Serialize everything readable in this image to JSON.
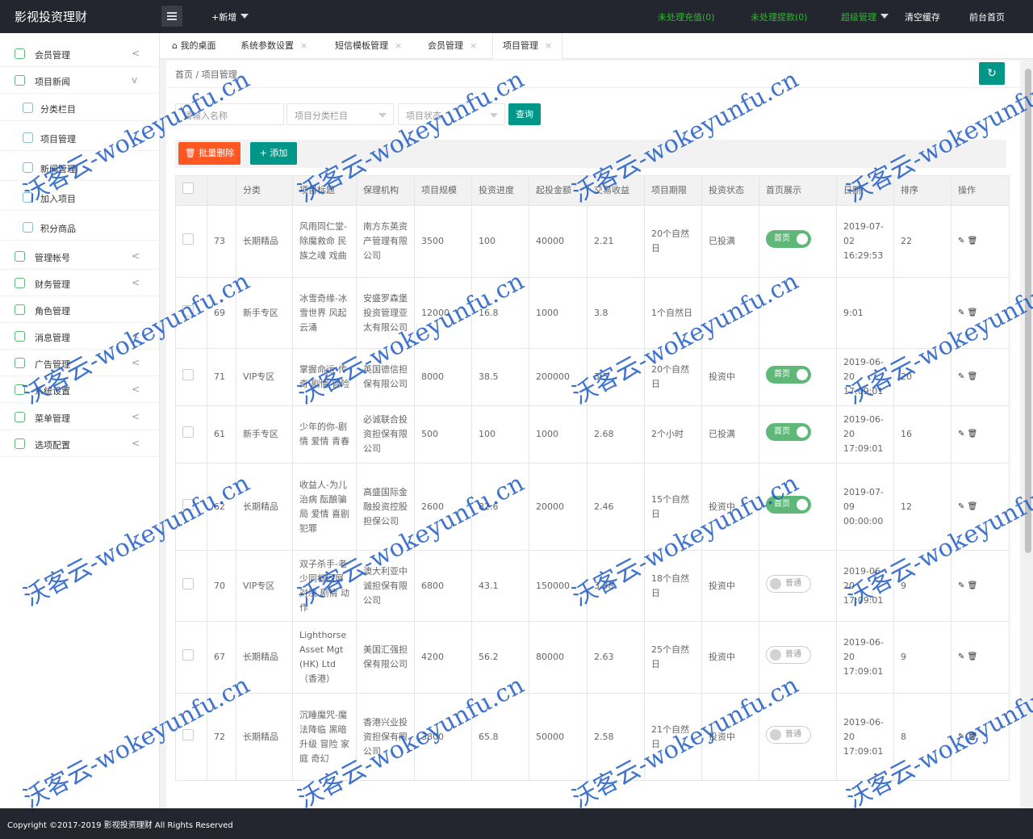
{
  "app": {
    "title": "影视投资理财"
  },
  "topbar": {
    "new_label": "+新增",
    "pending_recharge": "未处理充值(0)",
    "pending_withdraw": "未处理提款(0)",
    "super_admin": "超级管理",
    "clear_cache": "清空缓存",
    "front_home": "前台首页"
  },
  "sidebar": {
    "items": [
      {
        "label": "会员管理"
      },
      {
        "label": "项目新闻"
      },
      {
        "label": "分类栏目"
      },
      {
        "label": "项目管理"
      },
      {
        "label": "新闻管理"
      },
      {
        "label": "加入项目"
      },
      {
        "label": "积分商品"
      },
      {
        "label": "管理帐号"
      },
      {
        "label": "财务管理"
      },
      {
        "label": "角色管理"
      },
      {
        "label": "消息管理"
      },
      {
        "label": "广告管理"
      },
      {
        "label": "系统设置"
      },
      {
        "label": "菜单管理"
      },
      {
        "label": "选项配置"
      }
    ]
  },
  "tabs": [
    {
      "label": "我的桌面"
    },
    {
      "label": "系统参数设置"
    },
    {
      "label": "短信模板管理"
    },
    {
      "label": "会员管理"
    },
    {
      "label": "项目管理"
    }
  ],
  "breadcrumb": {
    "home": "首页",
    "current": "项目管理"
  },
  "filters": {
    "name_placeholder": "请输入名称",
    "category_placeholder": "项目分类栏目",
    "status_placeholder": "项目状态",
    "query_label": "查询"
  },
  "toolbar": {
    "batch_delete": "批量删除",
    "add": "添加"
  },
  "table": {
    "headers": [
      "分类",
      "项目标题",
      "保理机构",
      "项目规模",
      "投资进度",
      "起投金额",
      "交易收益",
      "项目期限",
      "投资状态",
      "首页展示",
      "日期",
      "排序",
      "操作"
    ],
    "rows": [
      {
        "id": "73",
        "cat": "长期精品",
        "title": "风雨同仁堂-除魔救命 民族之魂 戏曲",
        "org": "南方东英资产管理有限公司",
        "scale": "3500",
        "progress": "100",
        "min": "40000",
        "profit": "2.21",
        "term": "20个自然日",
        "status": "已投满",
        "show": "首页",
        "show_on": true,
        "date": "2019-07-02 16:29:53",
        "sort": "22"
      },
      {
        "id": "69",
        "cat": "新手专区",
        "title": "冰雪奇缘-冰雪世界 风起云涌",
        "org": "安盛罗森堡投资管理亚太有限公司",
        "scale": "12000",
        "progress": "16.8",
        "min": "1000",
        "profit": "3.8",
        "term": "1个自然日",
        "status": "",
        "show": "",
        "show_on": null,
        "date": "9:01",
        "sort": ""
      },
      {
        "id": "71",
        "cat": "VIP专区",
        "title": "掌握命运-传奇 剧情 冒险",
        "org": "英国德信担保有限公司",
        "scale": "8000",
        "progress": "38.5",
        "min": "200000",
        "profit": "3.5",
        "term": "20个自然日",
        "status": "投资中",
        "show": "首页",
        "show_on": true,
        "date": "2019-06-20 17:09:01",
        "sort": "20"
      },
      {
        "id": "61",
        "cat": "新手专区",
        "title": "少年的你-剧情 爱情 青春",
        "org": "必诚联合投资担保有限公司",
        "scale": "500",
        "progress": "100",
        "min": "1000",
        "profit": "2.68",
        "term": "2个小时",
        "status": "已投满",
        "show": "首页",
        "show_on": true,
        "date": "2019-06-20 17:09:01",
        "sort": "16"
      },
      {
        "id": "62",
        "cat": "长期精品",
        "title": "收益人-为儿治病 酝酿骗局 爱情 喜剧 犯罪",
        "org": "高盛国际金融投资控股担保公司",
        "scale": "2600",
        "progress": "82.6",
        "min": "20000",
        "profit": "2.46",
        "term": "15个自然日",
        "status": "投资中",
        "show": "首页",
        "show_on": true,
        "date": "2019-07-09 00:00:00",
        "sort": "12"
      },
      {
        "id": "70",
        "cat": "VIP专区",
        "title": "双子杀手-老少同框同屏对决 剧情 动作",
        "org": "澳大利亚中诚担保有限公司",
        "scale": "6800",
        "progress": "43.1",
        "min": "150000",
        "profit": "3.38",
        "term": "18个自然日",
        "status": "投资中",
        "show": "普通",
        "show_on": false,
        "date": "2019-06-20 17:09:01",
        "sort": "9"
      },
      {
        "id": "67",
        "cat": "长期精品",
        "title": "Lighthorse Asset Mgt (HK) Ltd（香港）",
        "org": "美国汇强担保有限公司",
        "scale": "4200",
        "progress": "56.2",
        "min": "80000",
        "profit": "2.63",
        "term": "25个自然日",
        "status": "投资中",
        "show": "普通",
        "show_on": false,
        "date": "2019-06-20 17:09:01",
        "sort": "9"
      },
      {
        "id": "72",
        "cat": "长期精品",
        "title": "沉睡魔咒-魔法降临 黑暗升级 冒险 家庭 奇幻",
        "org": "香港兴业投资担保有限公司",
        "scale": "3800",
        "progress": "65.8",
        "min": "50000",
        "profit": "2.58",
        "term": "21个自然日",
        "status": "投资中",
        "show": "普通",
        "show_on": false,
        "date": "2019-06-20 17:09:01",
        "sort": "8"
      }
    ]
  },
  "footer": {
    "copyright": "Copyright ©2017-2019 影视投资理财 All Rights Reserved"
  },
  "watermark": {
    "text": "沃客云-wokeyunfu.cn",
    "color": "#1e5bc6"
  },
  "colors": {
    "primary": "#009688",
    "danger": "#ff5722",
    "switch_on": "#5fb878",
    "topbar": "#23262e"
  }
}
